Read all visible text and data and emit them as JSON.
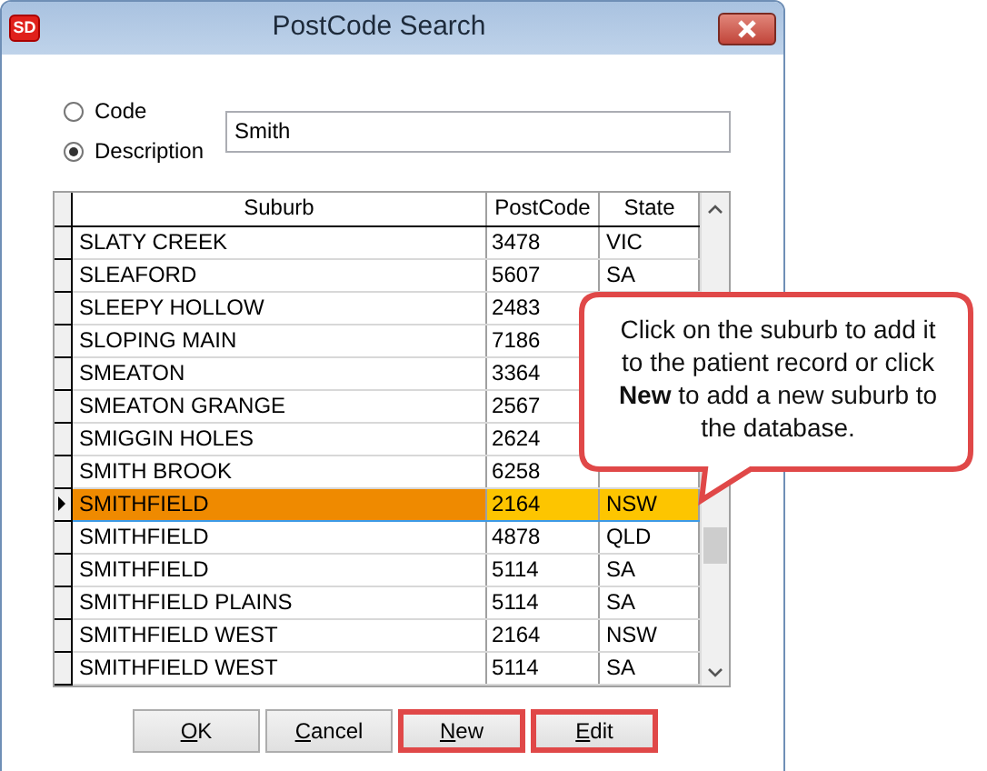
{
  "window": {
    "title": "PostCode Search",
    "app_icon": "SD"
  },
  "search_mode": [
    {
      "label": "Code",
      "selected": false
    },
    {
      "label": "Description",
      "selected": true
    }
  ],
  "search_field": {
    "value": "Smith"
  },
  "table": {
    "columns": [
      "Suburb",
      "PostCode",
      "State"
    ],
    "rows": [
      {
        "suburb": "SLATY CREEK",
        "postcode": "3478",
        "state": "VIC",
        "selected": false
      },
      {
        "suburb": "SLEAFORD",
        "postcode": "5607",
        "state": "SA",
        "selected": false
      },
      {
        "suburb": "SLEEPY HOLLOW",
        "postcode": "2483",
        "selected": false
      },
      {
        "suburb": "SLOPING MAIN",
        "postcode": "7186",
        "selected": false
      },
      {
        "suburb": "SMEATON",
        "postcode": "3364",
        "selected": false
      },
      {
        "suburb": "SMEATON GRANGE",
        "postcode": "2567",
        "selected": false
      },
      {
        "suburb": "SMIGGIN HOLES",
        "postcode": "2624",
        "selected": false
      },
      {
        "suburb": "SMITH BROOK",
        "postcode": "6258",
        "selected": false
      },
      {
        "suburb": "SMITHFIELD",
        "postcode": "2164",
        "state": "NSW",
        "selected": true
      },
      {
        "suburb": "SMITHFIELD",
        "postcode": "4878",
        "state": "QLD",
        "selected": false
      },
      {
        "suburb": "SMITHFIELD",
        "postcode": "5114",
        "state": "SA",
        "selected": false
      },
      {
        "suburb": "SMITHFIELD PLAINS",
        "postcode": "5114",
        "state": "SA",
        "selected": false
      },
      {
        "suburb": "SMITHFIELD WEST",
        "postcode": "2164",
        "state": "NSW",
        "selected": false
      },
      {
        "suburb": "SMITHFIELD WEST",
        "postcode": "5114",
        "state": "SA",
        "selected": false
      }
    ]
  },
  "buttons": [
    {
      "label": "OK",
      "highlighted": false
    },
    {
      "label": "Cancel",
      "highlighted": false
    },
    {
      "label": "New",
      "highlighted": true
    },
    {
      "label": "Edit",
      "highlighted": true
    }
  ],
  "callout": {
    "text": "Click on the suburb to add it to the patient record or click **New** to add a new suburb to the database."
  }
}
